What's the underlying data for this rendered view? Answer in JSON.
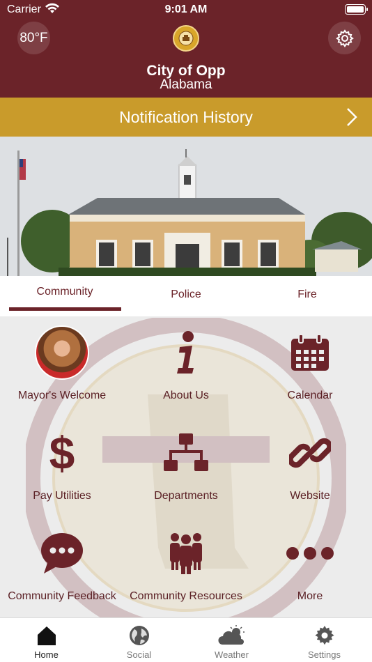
{
  "status_bar": {
    "carrier": "Carrier",
    "time": "9:01 AM"
  },
  "header": {
    "temperature": "80°F",
    "title": "City of Opp",
    "subtitle": "Alabama"
  },
  "notification_banner": {
    "label": "Notification History"
  },
  "tabs": [
    {
      "label": "Community",
      "selected": true
    },
    {
      "label": "Police",
      "selected": false
    },
    {
      "label": "Fire",
      "selected": false
    }
  ],
  "grid": [
    {
      "label": "Mayor's Welcome",
      "icon": "mayor-avatar"
    },
    {
      "label": "About Us",
      "icon": "info-icon"
    },
    {
      "label": "Calendar",
      "icon": "calendar-icon"
    },
    {
      "label": "Pay Utilities",
      "icon": "dollar-icon"
    },
    {
      "label": "Departments",
      "icon": "sitemap-icon"
    },
    {
      "label": "Website",
      "icon": "link-icon"
    },
    {
      "label": "Community Feedback",
      "icon": "chat-bubble-icon"
    },
    {
      "label": "Community Resources",
      "icon": "users-icon"
    },
    {
      "label": "More",
      "icon": "ellipsis-icon"
    }
  ],
  "tab_bar": [
    {
      "label": "Home",
      "icon": "home-icon",
      "active": true
    },
    {
      "label": "Social",
      "icon": "globe-icon",
      "active": false
    },
    {
      "label": "Weather",
      "icon": "cloud-sun-icon",
      "active": false
    },
    {
      "label": "Settings",
      "icon": "gear-icon",
      "active": false
    }
  ],
  "colors": {
    "primary": "#6b2329",
    "accent": "#c99b2b",
    "background": "#ececec"
  }
}
